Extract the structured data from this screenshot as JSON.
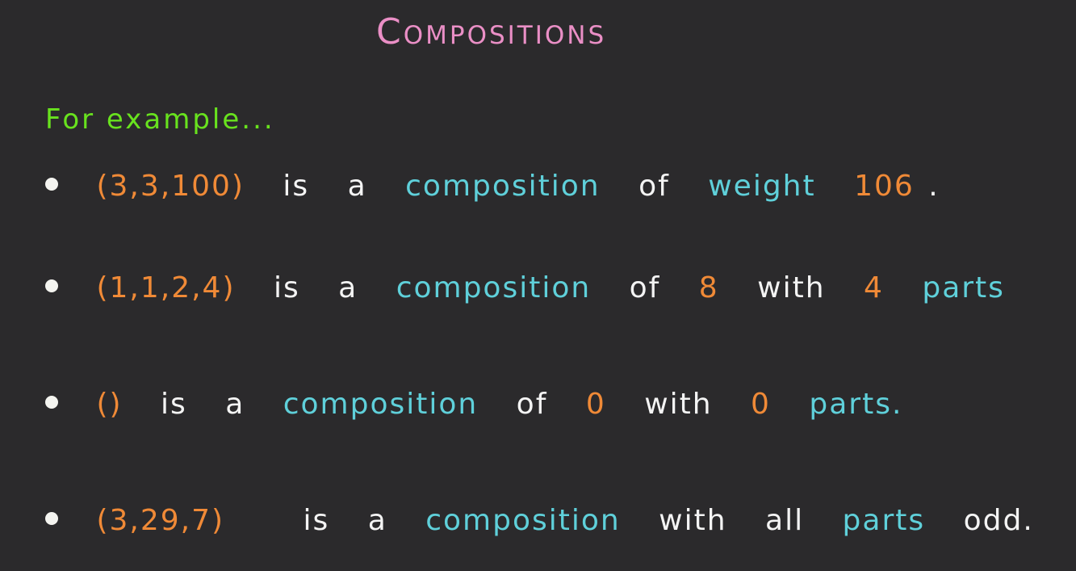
{
  "title": "Compositions",
  "subtitle": "For example...",
  "lines": [
    {
      "tuple": "(3,3,100)",
      "w1": "is",
      "w2": "a",
      "w3": "composition",
      "w4": "of",
      "w5": "weight",
      "w6": "106",
      "w7": "."
    },
    {
      "tuple": "(1,1,2,4)",
      "w1": "is",
      "w2": "a",
      "w3": "composition",
      "w4": "of",
      "w5": "8",
      "w6": "with",
      "w7": "4",
      "w8": "parts"
    },
    {
      "tuple": "()",
      "w1": "is",
      "w2": "a",
      "w3": "composition",
      "w4": "of",
      "w5": "0",
      "w6": "with",
      "w7": "0",
      "w8": "parts."
    },
    {
      "tuple": "(3,29,7)",
      "w1": "is",
      "w2": "a",
      "w3": "composition",
      "w4": "with",
      "w5": "all",
      "w6": "parts",
      "w7": "odd."
    }
  ],
  "colors": {
    "background": "#2b2a2c",
    "title": "#ea8fc6",
    "subtitle": "#68e21e",
    "tuple": "#f08a37",
    "term": "#5fd0da",
    "text": "#f4f4f4"
  }
}
